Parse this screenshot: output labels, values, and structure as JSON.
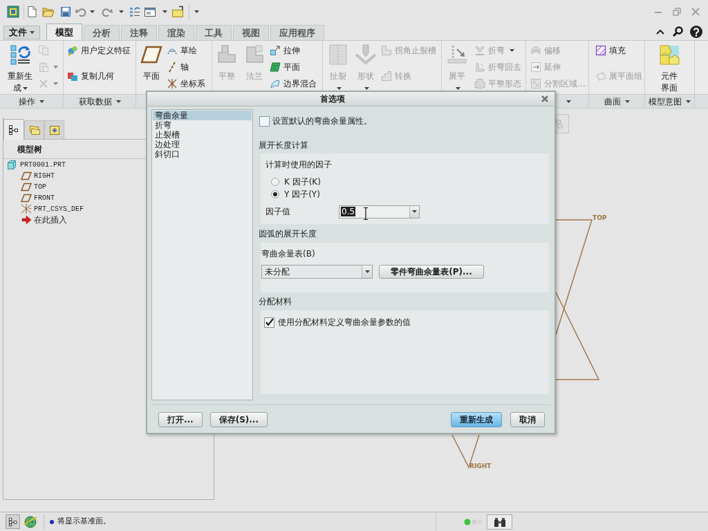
{
  "ribbon_tabs": [
    {
      "label": "文件",
      "kind": "menu",
      "selected": false
    },
    {
      "label": "模型",
      "kind": "tab",
      "selected": true
    },
    {
      "label": "分析",
      "kind": "tab",
      "selected": false
    },
    {
      "label": "注释",
      "kind": "tab",
      "selected": false
    },
    {
      "label": "渲染",
      "kind": "tab",
      "selected": false
    },
    {
      "label": "工具",
      "kind": "tab",
      "selected": false
    },
    {
      "label": "视图",
      "kind": "tab",
      "selected": false
    },
    {
      "label": "应用程序",
      "kind": "tab",
      "selected": false
    }
  ],
  "ribbon_groups": [
    {
      "label": "操作",
      "menu": true,
      "items": [
        {
          "kind": "large",
          "label": "重新生成",
          "dropdown": true,
          "disabled": false
        },
        {
          "kind": "icon",
          "dropdown": false,
          "disabled": true
        },
        {
          "kind": "icon",
          "dropdown": true,
          "disabled": true
        },
        {
          "kind": "icon",
          "dropdown": true,
          "disabled": true
        }
      ]
    },
    {
      "label": "获取数据",
      "menu": true,
      "items": [
        {
          "kind": "small",
          "label": "用户定义特征",
          "dropdown": false,
          "disabled": false
        },
        {
          "kind": "small",
          "label": "复制几何",
          "dropdown": false,
          "disabled": false
        }
      ]
    },
    {
      "items": [
        {
          "kind": "large",
          "label": "平面",
          "dropdown": false,
          "disabled": false
        },
        {
          "kind": "small",
          "label": "草绘",
          "dropdown": false,
          "disabled": false
        },
        {
          "kind": "small",
          "label": "轴",
          "dropdown": false,
          "disabled": false
        },
        {
          "kind": "small",
          "label": "坐标系",
          "dropdown": false,
          "disabled": false
        }
      ]
    },
    {
      "items": [
        {
          "kind": "large",
          "label": "平整",
          "dropdown": false,
          "disabled": true
        },
        {
          "kind": "large",
          "label": "法兰",
          "dropdown": false,
          "disabled": true
        },
        {
          "kind": "small",
          "label": "拉伸",
          "dropdown": false,
          "disabled": false
        },
        {
          "kind": "small",
          "label": "平面",
          "dropdown": false,
          "disabled": false
        },
        {
          "kind": "small",
          "label": "边界混合",
          "dropdown": false,
          "disabled": false
        }
      ]
    },
    {
      "items": [
        {
          "kind": "large",
          "label": "扯裂",
          "dropdown": true,
          "disabled": true
        },
        {
          "kind": "large",
          "label": "形状",
          "dropdown": true,
          "disabled": true
        },
        {
          "kind": "small",
          "label": "拐角止裂槽",
          "dropdown": false,
          "disabled": true
        },
        {
          "kind": "small",
          "label": "转换",
          "dropdown": false,
          "disabled": true
        }
      ]
    },
    {
      "items": [
        {
          "kind": "large",
          "label": "展平",
          "dropdown": true,
          "disabled": true
        },
        {
          "kind": "small",
          "label": "折弯",
          "dropdown": true,
          "disabled": true
        },
        {
          "kind": "small",
          "label": "折弯回去",
          "dropdown": false,
          "disabled": true
        },
        {
          "kind": "small",
          "label": "平整形态",
          "dropdown": false,
          "disabled": true
        }
      ]
    },
    {
      "menu": true,
      "items": [
        {
          "kind": "small",
          "label": "偏移",
          "dropdown": false,
          "disabled": true
        },
        {
          "kind": "small",
          "label": "延伸",
          "dropdown": false,
          "disabled": true
        },
        {
          "kind": "small",
          "label": "分割区域…",
          "dropdown": false,
          "disabled": true
        }
      ]
    },
    {
      "label": "曲面",
      "menu": true,
      "items": [
        {
          "kind": "small",
          "label": "填充",
          "dropdown": false,
          "disabled": false
        },
        {
          "kind": "small",
          "label": "展平面组",
          "dropdown": false,
          "disabled": true
        }
      ]
    },
    {
      "label": "模型意图",
      "menu": true,
      "items": [
        {
          "kind": "large",
          "label": "元件界面",
          "dropdown": false,
          "disabled": false
        }
      ]
    }
  ],
  "navigator": {
    "tabs": [
      {
        "selected": true
      },
      {
        "selected": false
      },
      {
        "selected": false
      }
    ],
    "title": "模型树",
    "tree": [
      {
        "label": "PRT0001.PRT",
        "kind": "part",
        "children": [
          {
            "label": "RIGHT",
            "kind": "plane"
          },
          {
            "label": "TOP",
            "kind": "plane"
          },
          {
            "label": "FRONT",
            "kind": "plane"
          },
          {
            "label": "PRT_CSYS_DEF",
            "kind": "csys"
          },
          {
            "label": "在此插入",
            "kind": "insert"
          }
        ]
      }
    ]
  },
  "graphics": {
    "datum_labels": [
      "TOP",
      "RIGHT"
    ]
  },
  "dialog": {
    "title": "首选项",
    "categories": [
      {
        "label": "弯曲余量",
        "selected": true
      },
      {
        "label": "折弯",
        "selected": false
      },
      {
        "label": "止裂槽",
        "selected": false
      },
      {
        "label": "边处理",
        "selected": false
      },
      {
        "label": "斜切口",
        "selected": false
      }
    ],
    "default_checkbox": {
      "label": "设置默认的弯曲余量属性。",
      "checked": false
    },
    "sections": [
      {
        "title": "展开长度计算",
        "kind": "factor",
        "subtitle": "计算时使用的因子",
        "options": [
          {
            "label": "K 因子(K)",
            "selected": false
          },
          {
            "label": "Y 因子(Y)",
            "selected": true
          }
        ],
        "value_label": "因子值",
        "value": "0.5",
        "value_selected": true
      },
      {
        "title": "圆弧的展开长度",
        "kind": "table",
        "field_label": "弯曲余量表(B)",
        "value": "未分配",
        "button": "零件弯曲余量表(P)..."
      },
      {
        "title": "分配材料",
        "kind": "material",
        "checkbox": {
          "label": "使用分配材料定义弯曲余量参数的值",
          "checked": true
        }
      }
    ],
    "buttons_left": [
      "打开...",
      "保存(S)..."
    ],
    "buttons_right": [
      {
        "label": "重新生成",
        "default": true
      },
      {
        "label": "取消",
        "default": false
      }
    ]
  },
  "status_bar": {
    "message": "将显示基准面。"
  }
}
